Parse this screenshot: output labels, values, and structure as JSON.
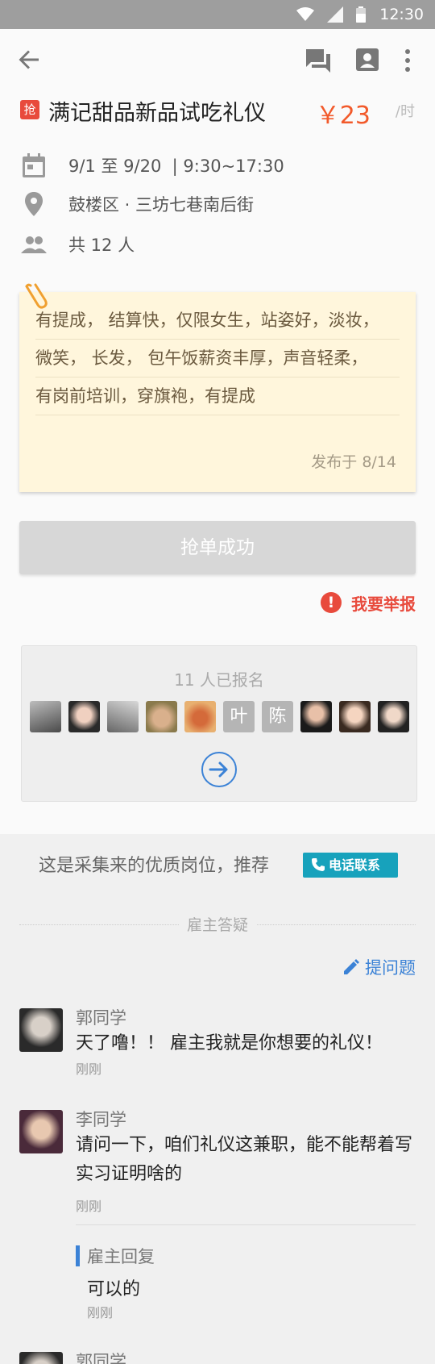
{
  "status_bar": {
    "time": "12:30"
  },
  "job": {
    "badge": "抢",
    "title": "满记甜品新品试吃礼仪",
    "price": "￥23",
    "unit": "/时",
    "date_time": "9/1 至 9/20  | 9:30~17:30",
    "location": "鼓楼区 · 三坊七巷南后街",
    "people": "共 12 人"
  },
  "note": {
    "lines": [
      "有提成， 结算快，仅限女生，站姿好，淡妆，",
      "微笑， 长发， 包午饭薪资丰厚，声音轻柔，",
      "有岗前培训，穿旗袍，有提成"
    ],
    "published": "发布于 8/14"
  },
  "grab_button": "抢单成功",
  "report_label": "我要举报",
  "signed_up": {
    "count_text": "11 人已报名",
    "avatar_letters": {
      "a6": "叶",
      "a7": "陈"
    }
  },
  "recommend": {
    "text": "这是采集来的优质岗位，推荐",
    "phone_label": "电话联系"
  },
  "qa": {
    "title": "雇主答疑",
    "ask_label": "提问题",
    "items": [
      {
        "name": "郭同学",
        "text": "天了噜！！ 雇主我就是你想要的礼仪！",
        "time": "刚刚"
      },
      {
        "name": "李同学",
        "text": "请问一下，咱们礼仪这兼职，能不能帮着写实习证明啥的",
        "time": "刚刚",
        "reply": {
          "label": "雇主回复",
          "text": "可以的",
          "time": "刚刚"
        }
      },
      {
        "name": "郭同学"
      }
    ]
  },
  "colors": {
    "accent_red": "#e84a3c",
    "price_orange": "#f25a2b",
    "link_blue": "#3b82d6",
    "phone_teal": "#17a2bc",
    "note_bg": "#fff6dc"
  }
}
